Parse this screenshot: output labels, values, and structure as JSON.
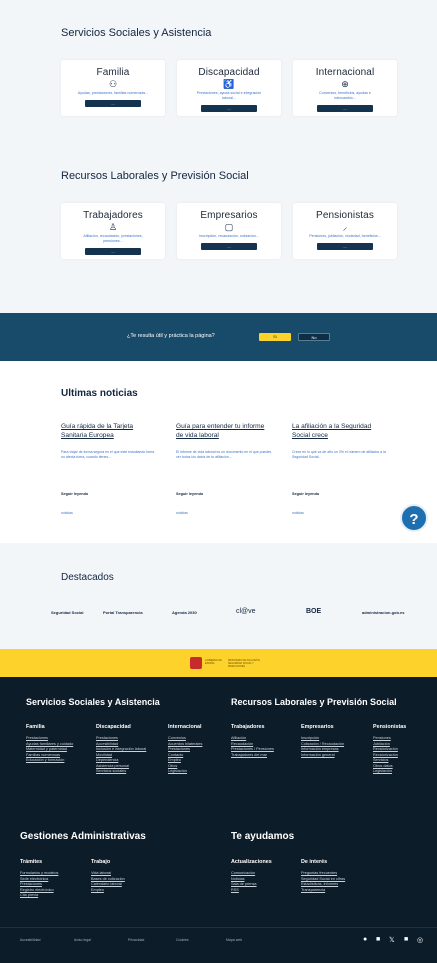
{
  "servicios": {
    "title": "Servicios Sociales y Asistencia",
    "cards": [
      {
        "title": "Familia",
        "icon": "family-icon",
        "glyph": "⚇",
        "desc": "Ayudas, prestaciones, familias numerosas...",
        "btn": "..."
      },
      {
        "title": "Discapacidad",
        "icon": "wheelchair-icon",
        "glyph": "♿",
        "desc": "Prestaciones, ayuda social e integración laboral...",
        "btn": "..."
      },
      {
        "title": "Internacional",
        "icon": "globe-icon",
        "glyph": "⊕",
        "desc": "Convenios, beneficios, ayudas e intercambio...",
        "btn": "..."
      }
    ]
  },
  "recursos": {
    "title": "Recursos Laborales y Previsión Social",
    "cards": [
      {
        "title": "Trabajadores",
        "icon": "worker-icon",
        "glyph": "♙",
        "desc": "Afiliación, recaudación, prestaciones, pensiones...",
        "btn": "..."
      },
      {
        "title": "Empresarios",
        "icon": "briefcase-icon",
        "glyph": "▢",
        "desc": "Inscripción, recaudación, cotización...",
        "btn": "..."
      },
      {
        "title": "Pensionistas",
        "icon": "cane-icon",
        "glyph": "⸝",
        "desc": "Pensiones, jubilación, viudedad, beneficios...",
        "btn": "..."
      }
    ]
  },
  "feedback": {
    "question": "¿Te resulta útil y práctica la página?",
    "yes": "Sí",
    "no": "No"
  },
  "news": {
    "title": "Ultimas noticias",
    "items": [
      {
        "title": "Guía rápida de la Tarjeta Sanitaria Europea",
        "desc": "Para viajar de forma segura en el que esté estudiando fuera no afecta fuera, cuando tienes...",
        "meta": "Seguir leyendo",
        "link": "noticias"
      },
      {
        "title": "Guía para entender tu informe de vida laboral",
        "desc": "El informe de vida laboral es un documento en el que puedes ver todos los datos de tu afiliación...",
        "meta": "Seguir leyendo",
        "link": "noticias"
      },
      {
        "title": "La afiliación a la Seguridad Social crece",
        "desc": "Crece en lo que va de año un 3% el número de afiliados a la Seguridad Social...",
        "meta": "Seguir leyendo",
        "link": "noticias"
      }
    ]
  },
  "destacados": {
    "title": "Destacados",
    "logos": [
      "Seguridad Social",
      "Portal Transparencia",
      "Agenda 2030",
      "cl@ve",
      "BOE",
      "administracion.gob.es"
    ]
  },
  "gov": {
    "left": "GOBIERNO DE ESPAÑA",
    "right": "MINISTERIO DE INCLUSIÓN, SEGURIDAD SOCIAL Y MIGRACIONES"
  },
  "footer": {
    "h1": "Servicios Sociales y Asistencia",
    "h2": "Recursos Laborales y Previsión Social",
    "h3": "Gestiones Administrativas",
    "h4": "Te ayudamos",
    "cols1": [
      {
        "title": "Familia",
        "links": [
          "Prestaciones",
          "Ayudas familiares y cuidado",
          "Maternidad y paternidad",
          "Familias numerosas",
          "Educación y formación"
        ]
      },
      {
        "title": "Discapacidad",
        "links": [
          "Prestaciones",
          "Accesibilidad",
          "Inclusión e integración laboral",
          "Movilidad",
          "Dependencia",
          "Asistencia personal",
          "Servicios sociales"
        ]
      },
      {
        "title": "Internacional",
        "links": [
          "Convenios",
          "Acuerdos bilaterales",
          "Prestaciones",
          "Contacto",
          "Empleo",
          "Otros",
          "Legislación"
        ]
      }
    ],
    "cols2": [
      {
        "title": "Trabajadores",
        "links": [
          "Afiliación",
          "Recaudación",
          "Prestaciones / Pensiones",
          "Trabajadores del mar"
        ]
      },
      {
        "title": "Empresarios",
        "links": [
          "Inscripción",
          "Cotización / Recaudación",
          "Información empresas",
          "Información general"
        ]
      },
      {
        "title": "Pensionistas",
        "links": [
          "Pensiones",
          "Jubilación",
          "Revalorización",
          "Revalorización",
          "Servicios",
          "Otros datos",
          "Legislación"
        ]
      }
    ],
    "cols3": [
      {
        "title": "Trámites",
        "links": [
          "Formularios y modelos",
          "Sede electrónica",
          "Prestaciones",
          "Registro electrónico",
          "Cita previa"
        ]
      },
      {
        "title": "Trabajo",
        "links": [
          "Vida laboral",
          "Bases de cotización",
          "Calendario laboral",
          "Empleo"
        ]
      }
    ],
    "cols4": [
      {
        "title": "Actualizaciones",
        "links": [
          "Comunicación",
          "Noticias",
          "Sala de prensa",
          "RSS"
        ]
      },
      {
        "title": "De interés",
        "links": [
          "Preguntas frecuentes",
          "Seguridad Social en cifras",
          "Estadísticas, informes",
          "Transparencia"
        ]
      }
    ],
    "bottom": [
      "Accesibilidad",
      "Aviso legal",
      "Privacidad",
      "Cookies",
      "Mapa web"
    ],
    "social": [
      {
        "icon": "facebook-icon",
        "glyph": "●"
      },
      {
        "icon": "youtube-icon",
        "glyph": "■"
      },
      {
        "icon": "x-icon",
        "glyph": "𝕏"
      },
      {
        "icon": "linkedin-icon",
        "glyph": "■"
      },
      {
        "icon": "instagram-icon",
        "glyph": "◎"
      }
    ]
  }
}
